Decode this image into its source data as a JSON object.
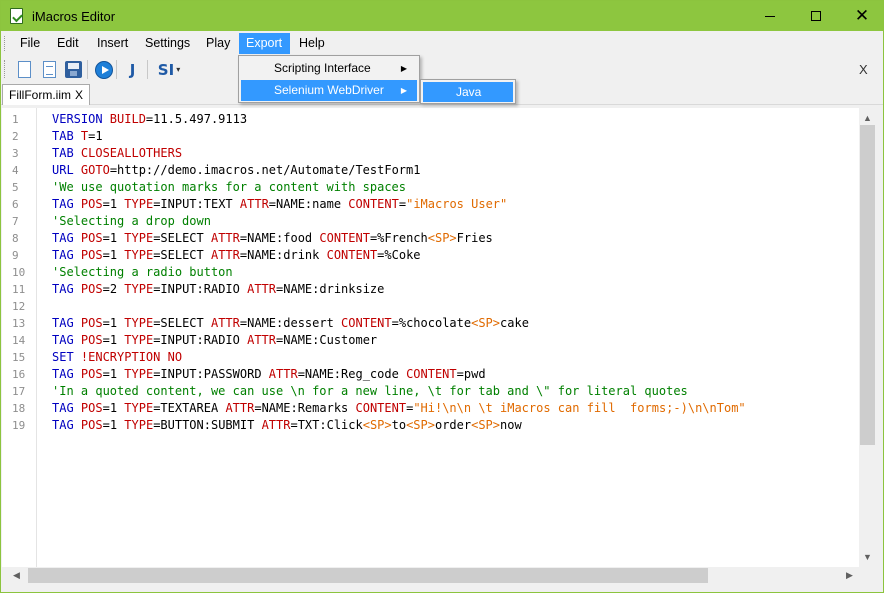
{
  "window": {
    "title": "iMacros Editor",
    "accent_color": "#8dc63f",
    "icon": "imacros-app-icon"
  },
  "menubar": {
    "items": [
      "File",
      "Edit",
      "Insert",
      "Settings",
      "Play",
      "Export",
      "Help"
    ],
    "active": "Export"
  },
  "toolbar": {
    "icons": [
      "new-document-icon",
      "open-document-icon",
      "save-icon",
      "play-icon",
      "java-icon",
      "si-icon"
    ],
    "java_label": "J",
    "si_label": "SI",
    "si_dropdown": "▾",
    "close_label": "X"
  },
  "tabs": [
    {
      "label": "FillForm.iim",
      "close": "X",
      "active": true
    }
  ],
  "export_menu": {
    "items": [
      {
        "label": "Scripting Interface",
        "submenu": true
      },
      {
        "label": "Selenium WebDriver",
        "submenu": true,
        "active": true
      }
    ],
    "submenu_items": [
      "Java"
    ],
    "submenu_arrow": "▶"
  },
  "editor": {
    "line_numbers": [
      "1",
      "2",
      "3",
      "4",
      "5",
      "6",
      "7",
      "8",
      "9",
      "10",
      "11",
      "12",
      "13",
      "14",
      "15",
      "16",
      "17",
      "18",
      "19"
    ],
    "lines": [
      [
        [
          "blue",
          "VERSION "
        ],
        [
          "red",
          "BUILD"
        ],
        [
          "black",
          "=11.5.497.9113"
        ]
      ],
      [
        [
          "blue",
          "TAB "
        ],
        [
          "red",
          "T"
        ],
        [
          "black",
          "=1"
        ]
      ],
      [
        [
          "blue",
          "TAB "
        ],
        [
          "red",
          "CLOSEALLOTHERS"
        ]
      ],
      [
        [
          "blue",
          "URL "
        ],
        [
          "red",
          "GOTO"
        ],
        [
          "black",
          "=http://demo.imacros.net/Automate/TestForm1"
        ]
      ],
      [
        [
          "green",
          "'We use quotation marks for a content with spaces"
        ]
      ],
      [
        [
          "blue",
          "TAG "
        ],
        [
          "red",
          "POS"
        ],
        [
          "black",
          "=1 "
        ],
        [
          "red",
          "TYPE"
        ],
        [
          "black",
          "=INPUT:TEXT "
        ],
        [
          "red",
          "ATTR"
        ],
        [
          "black",
          "=NAME:name "
        ],
        [
          "red",
          "CONTENT"
        ],
        [
          "black",
          "="
        ],
        [
          "orange",
          "\"iMacros User\""
        ]
      ],
      [
        [
          "green",
          "'Selecting a drop down"
        ]
      ],
      [
        [
          "blue",
          "TAG "
        ],
        [
          "red",
          "POS"
        ],
        [
          "black",
          "=1 "
        ],
        [
          "red",
          "TYPE"
        ],
        [
          "black",
          "=SELECT "
        ],
        [
          "red",
          "ATTR"
        ],
        [
          "black",
          "=NAME:food "
        ],
        [
          "red",
          "CONTENT"
        ],
        [
          "black",
          "=%French"
        ],
        [
          "orange",
          "<SP>"
        ],
        [
          "black",
          "Fries"
        ]
      ],
      [
        [
          "blue",
          "TAG "
        ],
        [
          "red",
          "POS"
        ],
        [
          "black",
          "=1 "
        ],
        [
          "red",
          "TYPE"
        ],
        [
          "black",
          "=SELECT "
        ],
        [
          "red",
          "ATTR"
        ],
        [
          "black",
          "=NAME:drink "
        ],
        [
          "red",
          "CONTENT"
        ],
        [
          "black",
          "=%Coke"
        ]
      ],
      [
        [
          "green",
          "'Selecting a radio button"
        ]
      ],
      [
        [
          "blue",
          "TAG "
        ],
        [
          "red",
          "POS"
        ],
        [
          "black",
          "=2 "
        ],
        [
          "red",
          "TYPE"
        ],
        [
          "black",
          "=INPUT:RADIO "
        ],
        [
          "red",
          "ATTR"
        ],
        [
          "black",
          "=NAME:drinksize"
        ]
      ],
      [],
      [
        [
          "blue",
          "TAG "
        ],
        [
          "red",
          "POS"
        ],
        [
          "black",
          "=1 "
        ],
        [
          "red",
          "TYPE"
        ],
        [
          "black",
          "=SELECT "
        ],
        [
          "red",
          "ATTR"
        ],
        [
          "black",
          "=NAME:dessert "
        ],
        [
          "red",
          "CONTENT"
        ],
        [
          "black",
          "=%chocolate"
        ],
        [
          "orange",
          "<SP>"
        ],
        [
          "black",
          "cake"
        ]
      ],
      [
        [
          "blue",
          "TAG "
        ],
        [
          "red",
          "POS"
        ],
        [
          "black",
          "=1 "
        ],
        [
          "red",
          "TYPE"
        ],
        [
          "black",
          "=INPUT:RADIO "
        ],
        [
          "red",
          "ATTR"
        ],
        [
          "black",
          "=NAME:Customer"
        ]
      ],
      [
        [
          "blue",
          "SET "
        ],
        [
          "red",
          "!ENCRYPTION NO"
        ]
      ],
      [
        [
          "blue",
          "TAG "
        ],
        [
          "red",
          "POS"
        ],
        [
          "black",
          "=1 "
        ],
        [
          "red",
          "TYPE"
        ],
        [
          "black",
          "=INPUT:PASSWORD "
        ],
        [
          "red",
          "ATTR"
        ],
        [
          "black",
          "=NAME:Reg_code "
        ],
        [
          "red",
          "CONTENT"
        ],
        [
          "black",
          "=pwd"
        ]
      ],
      [
        [
          "green",
          "'In a quoted content, we can use \\n for a new line, \\t for tab and \\\" for literal quotes"
        ]
      ],
      [
        [
          "blue",
          "TAG "
        ],
        [
          "red",
          "POS"
        ],
        [
          "black",
          "=1 "
        ],
        [
          "red",
          "TYPE"
        ],
        [
          "black",
          "=TEXTAREA "
        ],
        [
          "red",
          "ATTR"
        ],
        [
          "black",
          "=NAME:Remarks "
        ],
        [
          "red",
          "CONTENT"
        ],
        [
          "black",
          "="
        ],
        [
          "orange",
          "\"Hi!\\n\\n \\t iMacros can fill  forms;-)\\n\\nTom\""
        ]
      ],
      [
        [
          "blue",
          "TAG "
        ],
        [
          "red",
          "POS"
        ],
        [
          "black",
          "=1 "
        ],
        [
          "red",
          "TYPE"
        ],
        [
          "black",
          "=BUTTON:SUBMIT "
        ],
        [
          "red",
          "ATTR"
        ],
        [
          "black",
          "=TXT:Click"
        ],
        [
          "orange",
          "<SP>"
        ],
        [
          "black",
          "to"
        ],
        [
          "orange",
          "<SP>"
        ],
        [
          "black",
          "order"
        ],
        [
          "orange",
          "<SP>"
        ],
        [
          "black",
          "now"
        ]
      ]
    ],
    "colors": {
      "blue": "#0000c0",
      "red": "#c00000",
      "green": "#008000",
      "orange": "#e06a00",
      "black": "#000000"
    }
  },
  "scrollbars": {
    "up": "▲",
    "down": "▼",
    "left": "◀",
    "right": "▶"
  }
}
